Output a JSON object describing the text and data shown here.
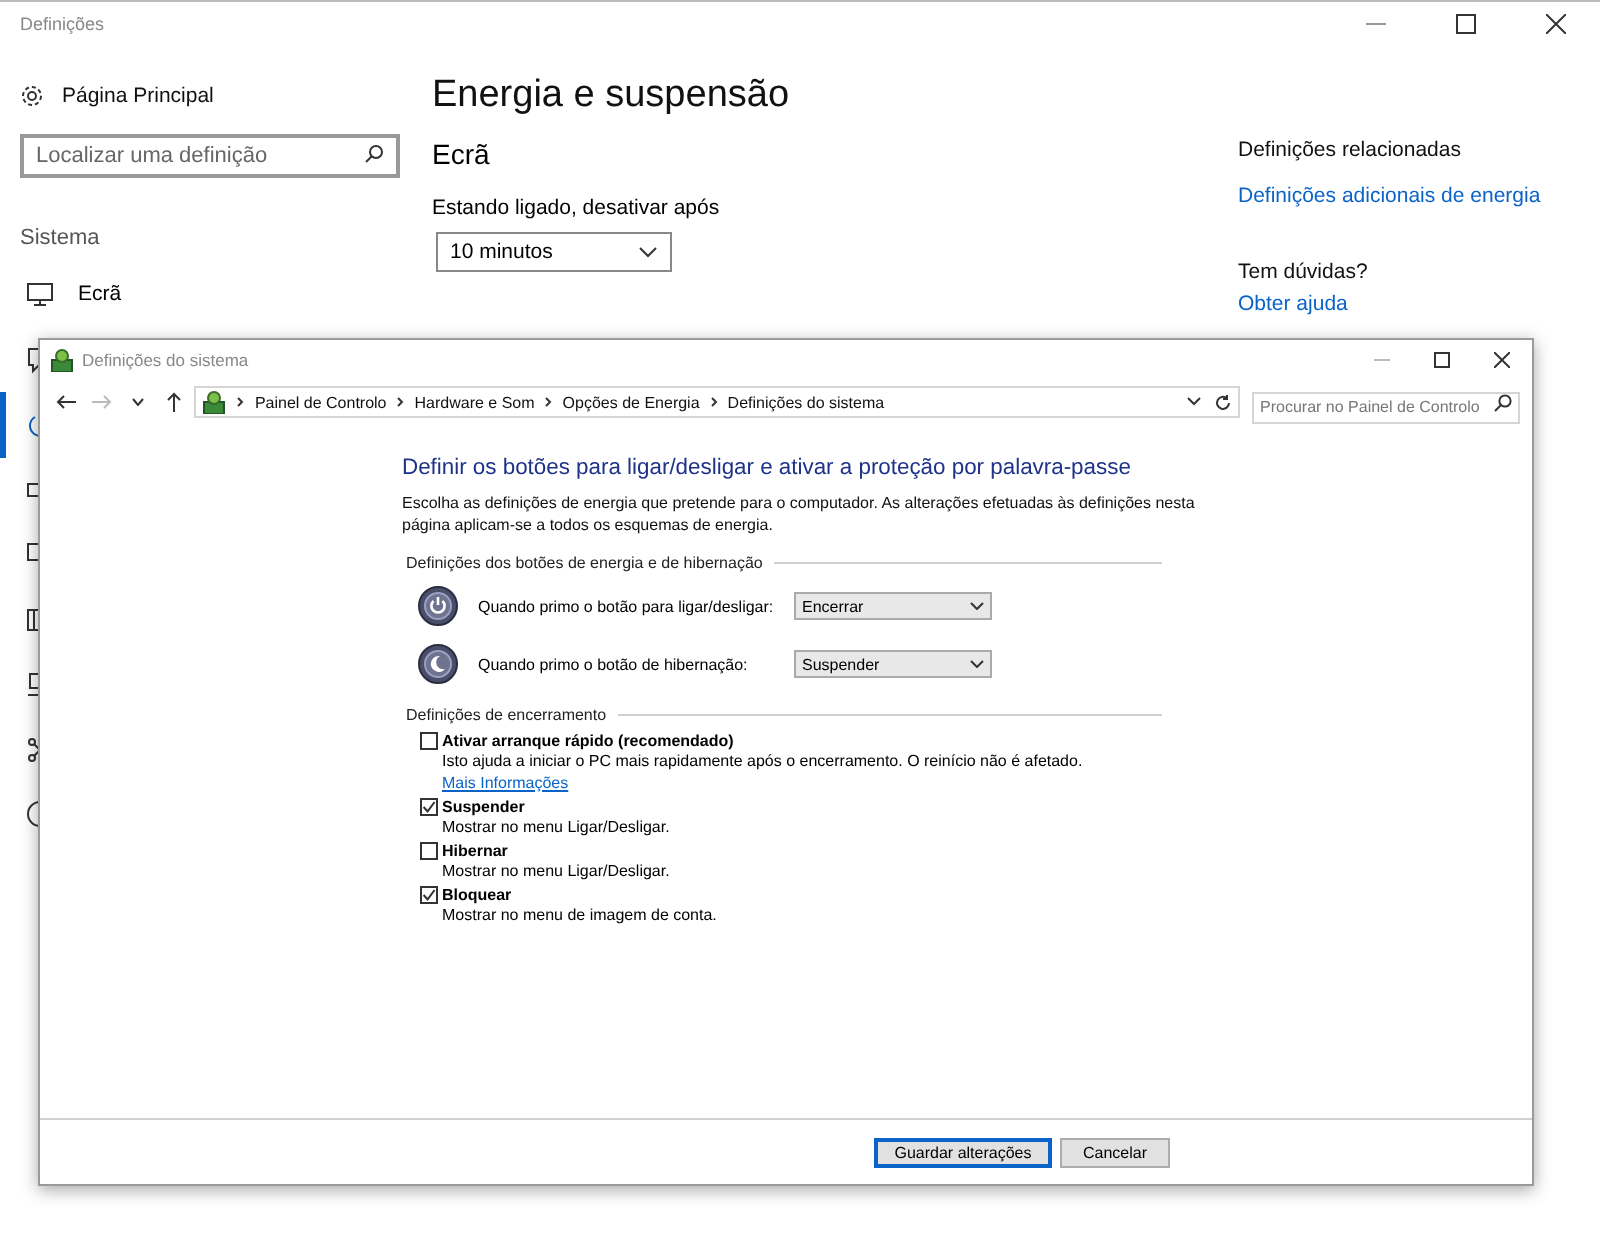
{
  "settings_window": {
    "title": "Definições",
    "sidebar": {
      "home": "Página Principal",
      "search_placeholder": "Localizar uma definição",
      "section": "Sistema",
      "items": [
        {
          "label": "Ecrã",
          "kind": "display",
          "selected": false
        },
        {
          "kind": "notifications",
          "selected": false
        },
        {
          "kind": "power",
          "selected": true
        },
        {
          "kind": "battery",
          "selected": false
        },
        {
          "kind": "storage",
          "selected": false
        },
        {
          "kind": "tablet",
          "selected": false
        },
        {
          "kind": "projecting",
          "selected": false
        },
        {
          "kind": "shared",
          "selected": false
        },
        {
          "kind": "about",
          "selected": false
        }
      ]
    },
    "main": {
      "title": "Energia e suspensão",
      "section": "Ecrã",
      "field_label": "Estando ligado, desativar após",
      "dropdown_value": "10 minutos"
    },
    "related": {
      "heading": "Definições relacionadas",
      "link": "Definições adicionais de energia",
      "help_heading": "Tem dúvidas?",
      "help_link": "Obter ajuda"
    }
  },
  "dialog": {
    "title": "Definições do sistema",
    "breadcrumb": [
      "Painel de Controlo",
      "Hardware e Som",
      "Opções de Energia",
      "Definições do sistema"
    ],
    "search_placeholder": "Procurar no Painel de Controlo",
    "heading": "Definir os botões para ligar/desligar e ativar a proteção por palavra-passe",
    "description": "Escolha as definições de energia que pretende para o computador. As alterações efetuadas às definições nesta página aplicam-se a todos os esquemas de energia.",
    "button_group": {
      "title": "Definições dos botões de energia e de hibernação",
      "rows": [
        {
          "kind": "power",
          "label": "Quando primo o botão para ligar/desligar:",
          "value": "Encerrar"
        },
        {
          "kind": "sleep",
          "label": "Quando primo o botão de hibernação:",
          "value": "Suspender"
        }
      ]
    },
    "shutdown_group": {
      "title": "Definições de encerramento",
      "options": [
        {
          "label": "Ativar arranque rápido (recomendado)",
          "checked": false,
          "description": "Isto ajuda a iniciar o PC mais rapidamente após o encerramento. O reinício não é afetado.",
          "link": "Mais Informações"
        },
        {
          "label": "Suspender",
          "checked": true,
          "description": "Mostrar no menu Ligar/Desligar."
        },
        {
          "label": "Hibernar",
          "checked": false,
          "description": "Mostrar no menu Ligar/Desligar."
        },
        {
          "label": "Bloquear",
          "checked": true,
          "description": "Mostrar no menu de imagem de conta."
        }
      ]
    },
    "buttons": [
      {
        "label": "Guardar alterações",
        "default": true
      },
      {
        "label": "Cancelar",
        "default": false
      }
    ]
  }
}
